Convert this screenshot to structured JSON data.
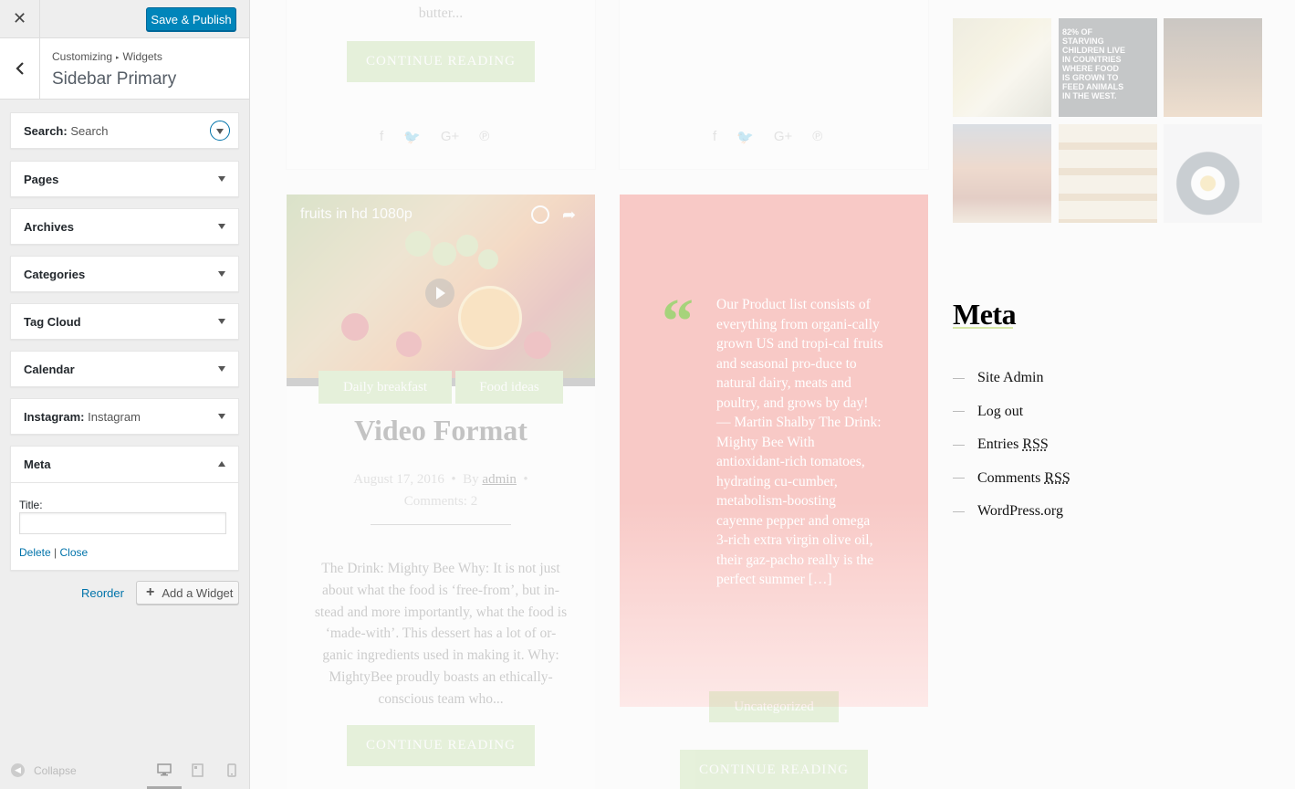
{
  "customizer": {
    "close_glyph": "✕",
    "save_label": "Save & Publish",
    "breadcrumb": {
      "first": "Customizing",
      "separator": "▸",
      "second": "Widgets"
    },
    "title": "Sidebar Primary",
    "widgets": [
      {
        "name": "Search",
        "suffix": "Search",
        "colon": ":"
      },
      {
        "name": "Pages"
      },
      {
        "name": "Archives"
      },
      {
        "name": "Categories"
      },
      {
        "name": "Tag Cloud"
      },
      {
        "name": "Calendar"
      },
      {
        "name": "Instagram",
        "suffix": "Instagram",
        "colon": ":"
      },
      {
        "name": "Meta"
      }
    ],
    "meta_form": {
      "title_label": "Title:",
      "title_value": "",
      "delete": "Delete",
      "separator": "|",
      "close": "Close"
    },
    "reorder_label": "Reorder",
    "add_widget_label": "Add a Widget",
    "collapse_label": "Collapse",
    "accent_color": "#0085ba"
  },
  "preview": {
    "card1": {
      "excerpt_tail": "butter...",
      "button": "CONTINUE READING"
    },
    "video_post": {
      "video_title": "fruits in hd 1080p",
      "tags": [
        "Daily breakfast",
        "Food ideas"
      ],
      "title": "Video Format",
      "date": "August 17, 2016",
      "by": "By",
      "author": "admin",
      "comments_label": "Comments:",
      "comments_count": "2",
      "excerpt": "The Drink: Mighty Bee Why: It is not just about what the food is ‘free-from’, but in-stead and more importantly, what the food is ‘made-with’. This dessert has a lot of or-ganic ingredients used in making it. Why: MightyBee proudly boasts an ethically-conscious team who...",
      "button": "CONTINUE READING"
    },
    "quote_post": {
      "quote_mark": "“",
      "text": "Our Product list consists of everything from organi-cally grown US and tropi-cal fruits and seasonal pro-duce to natural dairy, meats and poultry, and grows by day! — Martin Shalby The Drink: Mighty Bee With antioxidant-rich tomatoes, hydrating cu-cumber, metabolism-boosting cayenne pepper and omega 3-rich extra virgin olive oil, their gaz-pacho really is the perfect summer […]",
      "category": "Uncategorized",
      "button": "CONTINUE READING"
    },
    "instagram_tile_text": "82% of starving children live in countries where food is grown to feed animals in the west.",
    "meta": {
      "heading": "Meta",
      "links": [
        {
          "text": "Site Admin"
        },
        {
          "text": "Log out"
        },
        {
          "text": "Entries ",
          "abbr": "RSS"
        },
        {
          "text": "Comments ",
          "abbr": "RSS"
        },
        {
          "text": "WordPress.org"
        }
      ]
    },
    "accent_green": "#a6d37b",
    "quote_pink": "#f8c9c6"
  }
}
